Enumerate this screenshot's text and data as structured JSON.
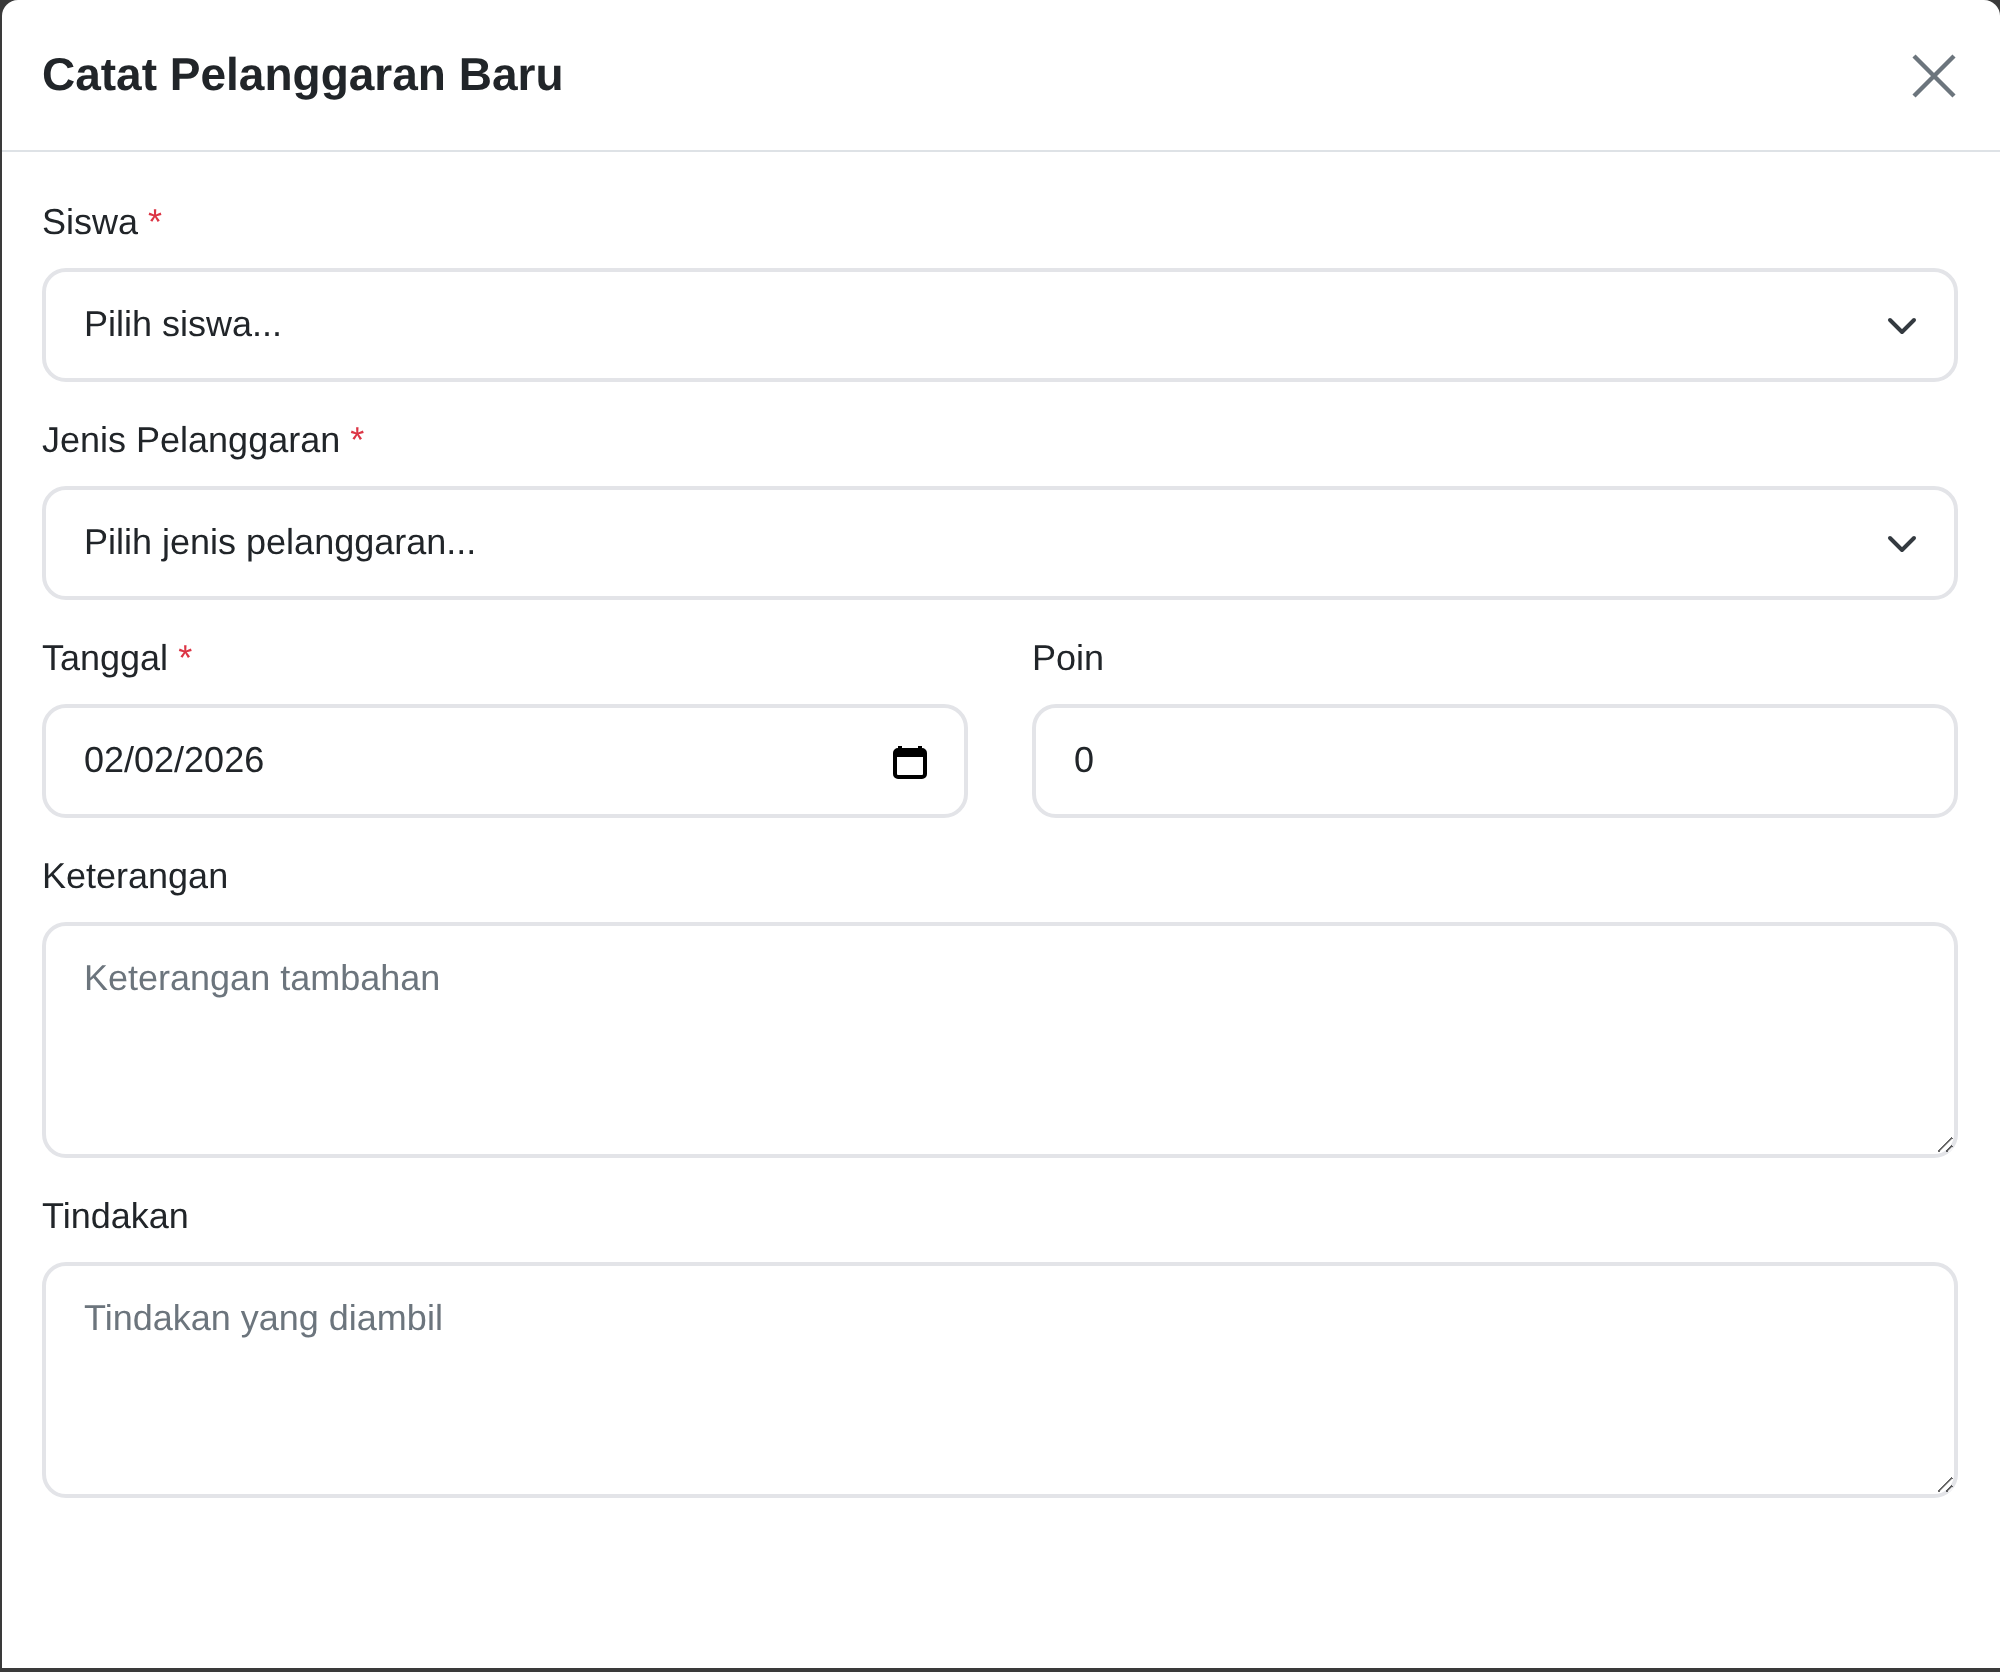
{
  "dialog": {
    "title": "Catat Pelanggaran Baru"
  },
  "rows": [
    {
      "fields": [
        {
          "kind": "select",
          "label": "Siswa",
          "required_mark": "*",
          "value": "Pilih siswa..."
        }
      ]
    },
    {
      "fields": [
        {
          "kind": "select",
          "label": "Jenis Pelanggaran",
          "required_mark": "*",
          "value": "Pilih jenis pelanggaran..."
        }
      ]
    },
    {
      "fields": [
        {
          "kind": "date",
          "label": "Tanggal",
          "required_mark": "*",
          "value": "02/02/2026"
        },
        {
          "kind": "number",
          "label": "Poin",
          "value": "0"
        }
      ]
    },
    {
      "fields": [
        {
          "kind": "textarea",
          "label": "Keterangan",
          "placeholder": "Keterangan tambahan"
        }
      ]
    },
    {
      "fields": [
        {
          "kind": "textarea",
          "label": "Tindakan",
          "placeholder": "Tindakan yang diambil"
        }
      ]
    }
  ]
}
